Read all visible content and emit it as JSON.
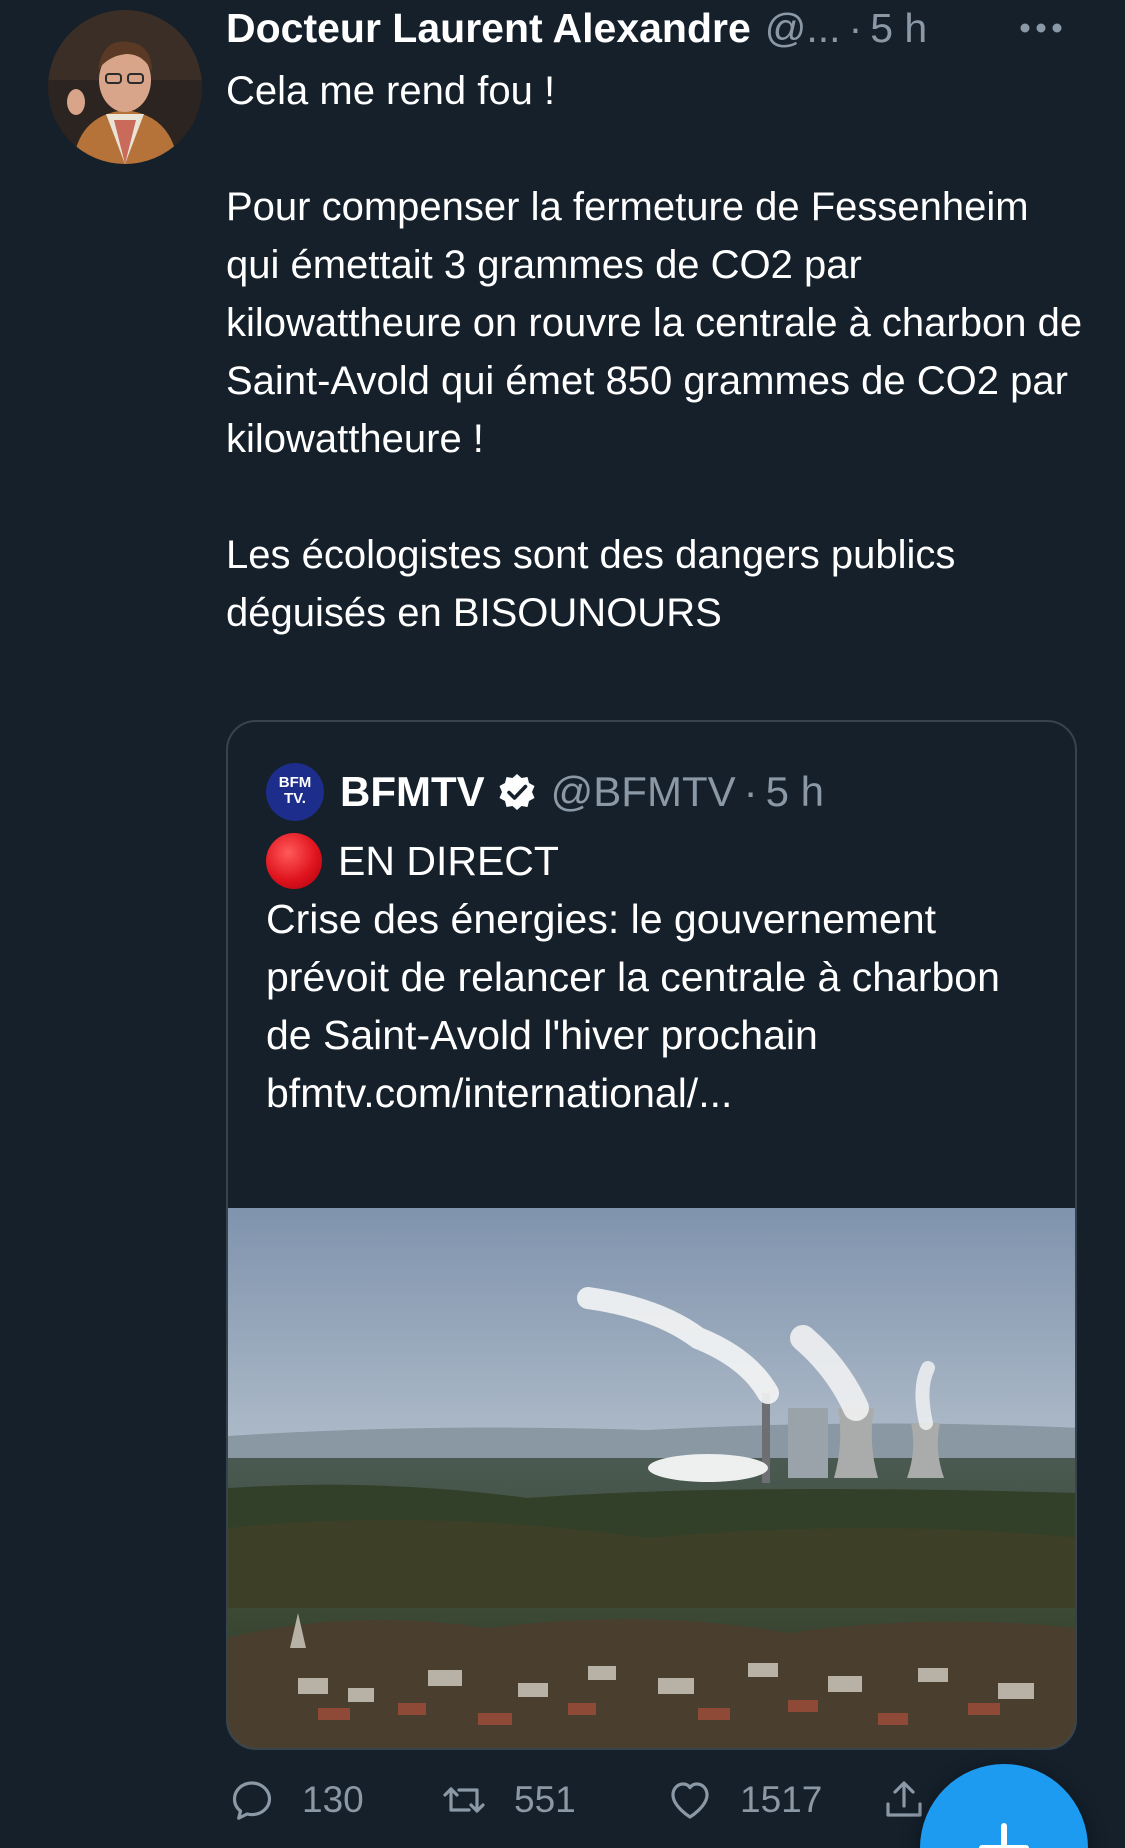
{
  "author": {
    "name": "Docteur Laurent Alexandre",
    "handle": "@...",
    "separator": "·",
    "time": "5 h"
  },
  "tweet": {
    "line1": "Cela me rend fou !",
    "paragraph2": "Pour compenser la fermeture de Fessenheim qui émettait 3 grammes de CO2 par kilowattheure on rouvre la centrale à charbon de Saint-Avold qui émet 850 grammes de CO2 par kilowattheure !",
    "paragraph3": "Les écologistes sont des dangers publics déguisés en BISOUNOURS"
  },
  "quoted": {
    "logo_text_line1": "BFM",
    "logo_text_line2": "TV.",
    "name": "BFMTV",
    "handle": "@BFMTV",
    "separator": "·",
    "time": "5 h",
    "live_label": "EN DIRECT",
    "body": "Crise des énergies: le gouvernement prévoit de relancer la centrale à charbon de Saint-Avold l'hiver prochain",
    "link": "bfmtv.com/international/..."
  },
  "actions": {
    "replies": "130",
    "retweets": "551",
    "likes": "1517"
  },
  "icons": {
    "more": "more-horizontal-icon",
    "verified": "verified-badge-icon",
    "reply": "reply-icon",
    "retweet": "retweet-icon",
    "like": "heart-icon",
    "share": "share-icon",
    "compose": "plus-icon"
  },
  "colors": {
    "background": "#15202b",
    "secondary_text": "#8b98a5",
    "border": "#38444d",
    "accent": "#1d9bf0",
    "live_red": "#e0141e"
  }
}
